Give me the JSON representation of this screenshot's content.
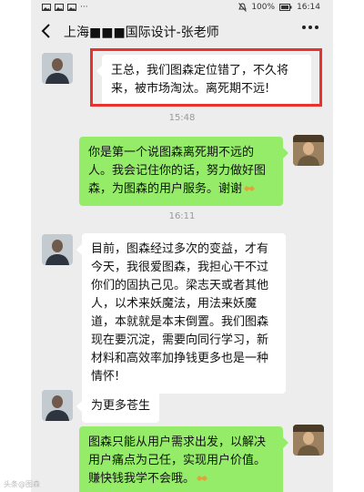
{
  "status": {
    "battery": "100%",
    "time": "16:14"
  },
  "header": {
    "title": "上海■■■国际设计-张老师"
  },
  "messages": [
    {
      "text": "王总，我们图森定位错了，不久将来，被市场淘汰。离死期不远!"
    },
    {
      "time": "15:48"
    },
    {
      "text": "你是第一个说图森离死期不远的人。我会记住你的话，努力做好图森，为图森的用户服务。谢谢"
    },
    {
      "time": "16:11"
    },
    {
      "text": "目前，图森经过多次的变益，才有今天，我很爱图森，我担心干不过你们的固执己见。梁志天或者其他人，以术来妖魔法，用法来妖魔道，本就就是本末倒置。我们图森现在要沉淀，需要向同行学习，新材料和高效率加挣钱更多也是一种情怀!"
    },
    {
      "text": "为更多苍生"
    },
    {
      "text": "图森只能从用户需求出发，以解决用户痛点为己任，实现用户价值。赚快钱我学不会哦。"
    }
  ],
  "watermark": "头条@图森"
}
